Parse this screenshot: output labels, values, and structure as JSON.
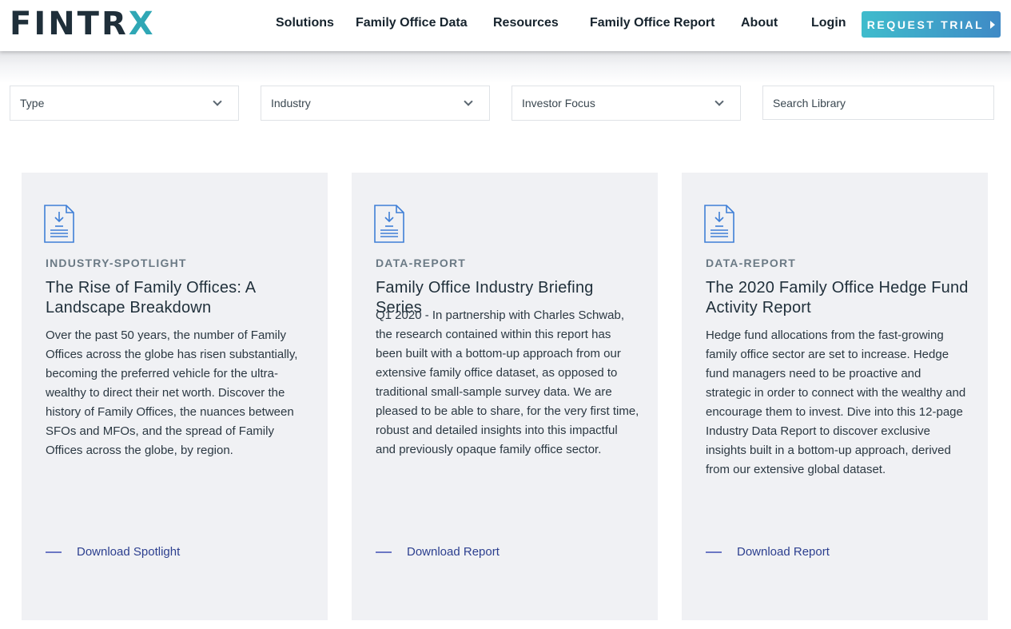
{
  "header": {
    "logo_text": "FINTRX",
    "nav": [
      {
        "label": "Solutions"
      },
      {
        "label": "Family Office Data"
      },
      {
        "label": "Resources"
      },
      {
        "label": "Family Office Report"
      },
      {
        "label": "About"
      },
      {
        "label": "Login"
      }
    ],
    "cta_label": "REQUEST TRIAL"
  },
  "filters": {
    "type": "Type",
    "industry": "Industry",
    "investor_focus": "Investor Focus",
    "search_placeholder": "Search Library"
  },
  "cards": [
    {
      "category": "INDUSTRY-SPOTLIGHT",
      "title": "The Rise of Family Offices: A Landscape Breakdown",
      "description": "Over the past 50 years, the number of Family Offices across the globe has risen substantially, becoming the preferred vehicle for the ultra-wealthy to direct their net worth. Discover the history of Family Offices, the nuances between SFOs and MFOs, and the spread of Family Offices across the globe, by region.",
      "link_label": "Download Spotlight"
    },
    {
      "category": "DATA-REPORT",
      "title": "Family Office Industry Briefing Series",
      "description": "Q1 2020 - In partnership with Charles Schwab, the research contained within this report has been built with a bottom-up approach from our extensive family office dataset, as opposed to traditional small-sample survey data. We are pleased to be able to share, for the very first time, robust and detailed insights into this impactful and previously opaque family office sector.",
      "link_label": "Download Report"
    },
    {
      "category": "DATA-REPORT",
      "title": "The 2020 Family Office Hedge Fund Activity Report",
      "description": "Hedge fund allocations from the fast-growing family office sector are set to increase.  Hedge fund managers need to be proactive and strategic in order to connect with the wealthy and encourage them to invest.  Dive into this 12-page Industry Data Report to discover exclusive insights built in a bottom-up approach, derived from our extensive global dataset.",
      "link_label": "Download Report"
    }
  ],
  "colors": {
    "logo_dark": "#1f2f3a",
    "logo_accent": "#2fa7b5",
    "cta_start": "#3fbccc",
    "cta_end": "#3f8ac6",
    "card_bg": "#f0f1f4",
    "link": "#2c3f8f",
    "icon": "#3f7fd6"
  }
}
